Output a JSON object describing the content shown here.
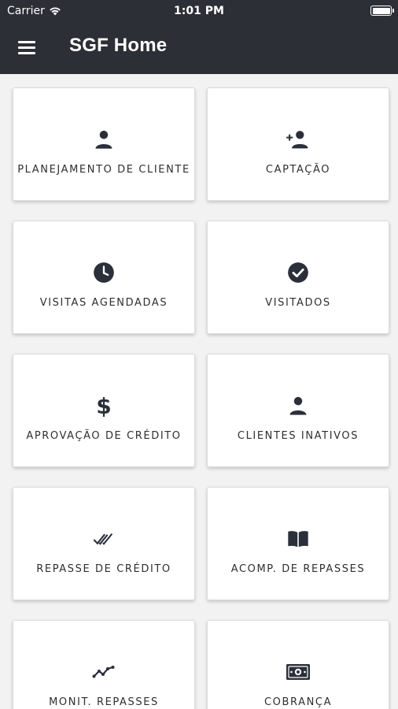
{
  "status_bar": {
    "carrier": "Carrier",
    "time": "1:01 PM"
  },
  "header": {
    "title": "SGF Home"
  },
  "colors": {
    "header_bg": "#2d2f36",
    "icon": "#2b2f3a",
    "card_bg": "#ffffff",
    "page_bg": "#f2f2f2"
  },
  "tiles": [
    {
      "label": "PLANEJAMENTO DE CLIENTE",
      "icon": "person-icon"
    },
    {
      "label": "CAPTAÇÃO",
      "icon": "add-person-icon"
    },
    {
      "label": "VISITAS AGENDADAS",
      "icon": "clock-icon"
    },
    {
      "label": "VISITADOS",
      "icon": "check-circle-icon"
    },
    {
      "label": "APROVAÇÃO DE CRÉDITO",
      "icon": "dollar-icon",
      "icon_text": "$"
    },
    {
      "label": "CLIENTES INATIVOS",
      "icon": "person-icon"
    },
    {
      "label": "REPASSE DE CRÉDITO",
      "icon": "double-check-icon"
    },
    {
      "label": "ACOMP. DE REPASSES",
      "icon": "book-icon"
    },
    {
      "label": "MONIT. REPASSES",
      "icon": "trending-icon"
    },
    {
      "label": "COBRANÇA",
      "icon": "money-icon"
    }
  ]
}
